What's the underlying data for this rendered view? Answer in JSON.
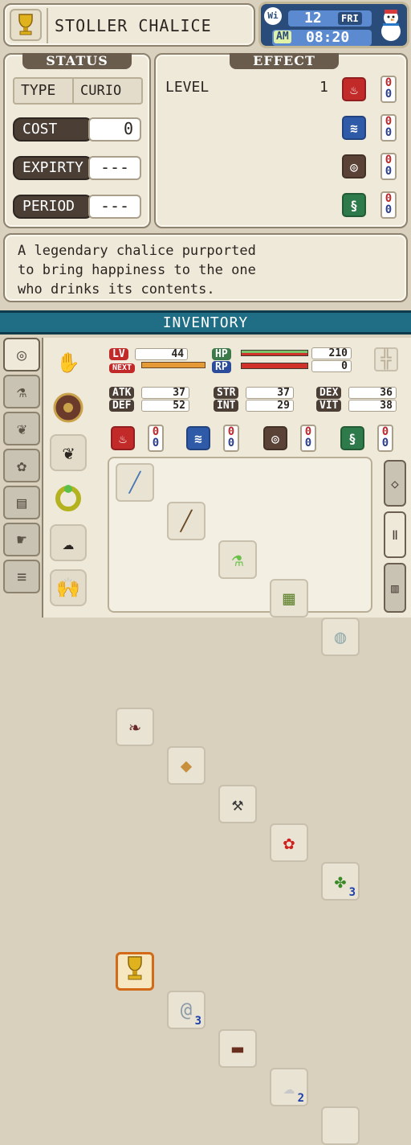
{
  "item": {
    "icon": "trophy-icon",
    "name": "STOLLER CHALICE"
  },
  "clock": {
    "wifi": "Wi",
    "day": "12",
    "weekday": "FRI",
    "ampm": "AM",
    "time": "08:20",
    "weather_icon": "snowman-icon"
  },
  "status": {
    "title": "STATUS",
    "type_label": "TYPE",
    "type_value": "CURIO",
    "cost_label": "COST",
    "cost_value": "0",
    "expiry_label": "EXPIRTY",
    "expiry_value": "---",
    "period_label": "PERIOD",
    "period_value": "---"
  },
  "effect": {
    "title": "EFFECT",
    "level_label": "LEVEL",
    "level_value": "1",
    "elements": [
      {
        "icon": "fire-icon",
        "color": "#c22a2a",
        "top": "0",
        "bottom": "0"
      },
      {
        "icon": "water-icon",
        "color": "#2f5aa8",
        "top": "0",
        "bottom": "0"
      },
      {
        "icon": "earth-icon",
        "color": "#5a4236",
        "top": "0",
        "bottom": "0"
      },
      {
        "icon": "wind-icon",
        "color": "#2f7a4a",
        "top": "0",
        "bottom": "0"
      }
    ]
  },
  "description": {
    "line1": "A legendary chalice purported",
    "line2": "to bring happiness to the one",
    "line3": "who drinks its contents."
  },
  "inventory": {
    "title": "INVENTORY",
    "lv_label": "LV",
    "lv_value": "44",
    "next_label": "NEXT",
    "hp_label": "HP",
    "hp_value": "210",
    "rp_label": "RP",
    "rp_value": "0",
    "stats": {
      "atk_label": "ATK",
      "atk": "37",
      "def_label": "DEF",
      "def": "52",
      "str_label": "STR",
      "str": "37",
      "int_label": "INT",
      "int": "29",
      "dex_label": "DEX",
      "dex": "36",
      "vit_label": "VIT",
      "vit": "38"
    },
    "resist": [
      {
        "icon": "fire-icon",
        "color": "#c22a2a",
        "top": "0",
        "bottom": "0"
      },
      {
        "icon": "water-icon",
        "color": "#2f5aa8",
        "top": "0",
        "bottom": "0"
      },
      {
        "icon": "earth-icon",
        "color": "#5a4236",
        "top": "0",
        "bottom": "0"
      },
      {
        "icon": "wind-icon",
        "color": "#2f7a4a",
        "top": "0",
        "bottom": "0"
      }
    ],
    "side_tabs": [
      "target-icon",
      "flask-icon",
      "rabbit-icon",
      "fruit-icon",
      "book-icon",
      "handshake-icon",
      "list-icon"
    ],
    "equip": [
      "gauntlet-icon",
      "shield-icon",
      "cape-icon",
      "ring-icon",
      "feather-icon",
      "hands-icon"
    ],
    "items": [
      {
        "icon": "spear-icon",
        "glyph": "╱",
        "count": ""
      },
      {
        "icon": "staff-icon",
        "glyph": "╱",
        "count": ""
      },
      {
        "icon": "potion-icon",
        "glyph": "⚗",
        "count": ""
      },
      {
        "icon": "crate-icon",
        "glyph": "▦",
        "count": ""
      },
      {
        "icon": "scroll-icon",
        "glyph": "◍",
        "count": ""
      },
      {
        "icon": "fish-icon",
        "glyph": "❧",
        "count": ""
      },
      {
        "icon": "bread-icon",
        "glyph": "◆",
        "count": ""
      },
      {
        "icon": "hoe-icon",
        "glyph": "⚒",
        "count": ""
      },
      {
        "icon": "rose-icon",
        "glyph": "✿",
        "count": ""
      },
      {
        "icon": "herb-icon",
        "glyph": "✤",
        "count": "3"
      },
      {
        "icon": "chalice-icon",
        "glyph": "🏆",
        "count": ""
      },
      {
        "icon": "whirlwind-icon",
        "glyph": "@",
        "count": "3"
      },
      {
        "icon": "brush-icon",
        "glyph": "▬",
        "count": ""
      },
      {
        "icon": "wool-icon",
        "glyph": "☁",
        "count": "2"
      },
      {
        "icon": "empty-slot",
        "glyph": "",
        "count": ""
      }
    ]
  }
}
